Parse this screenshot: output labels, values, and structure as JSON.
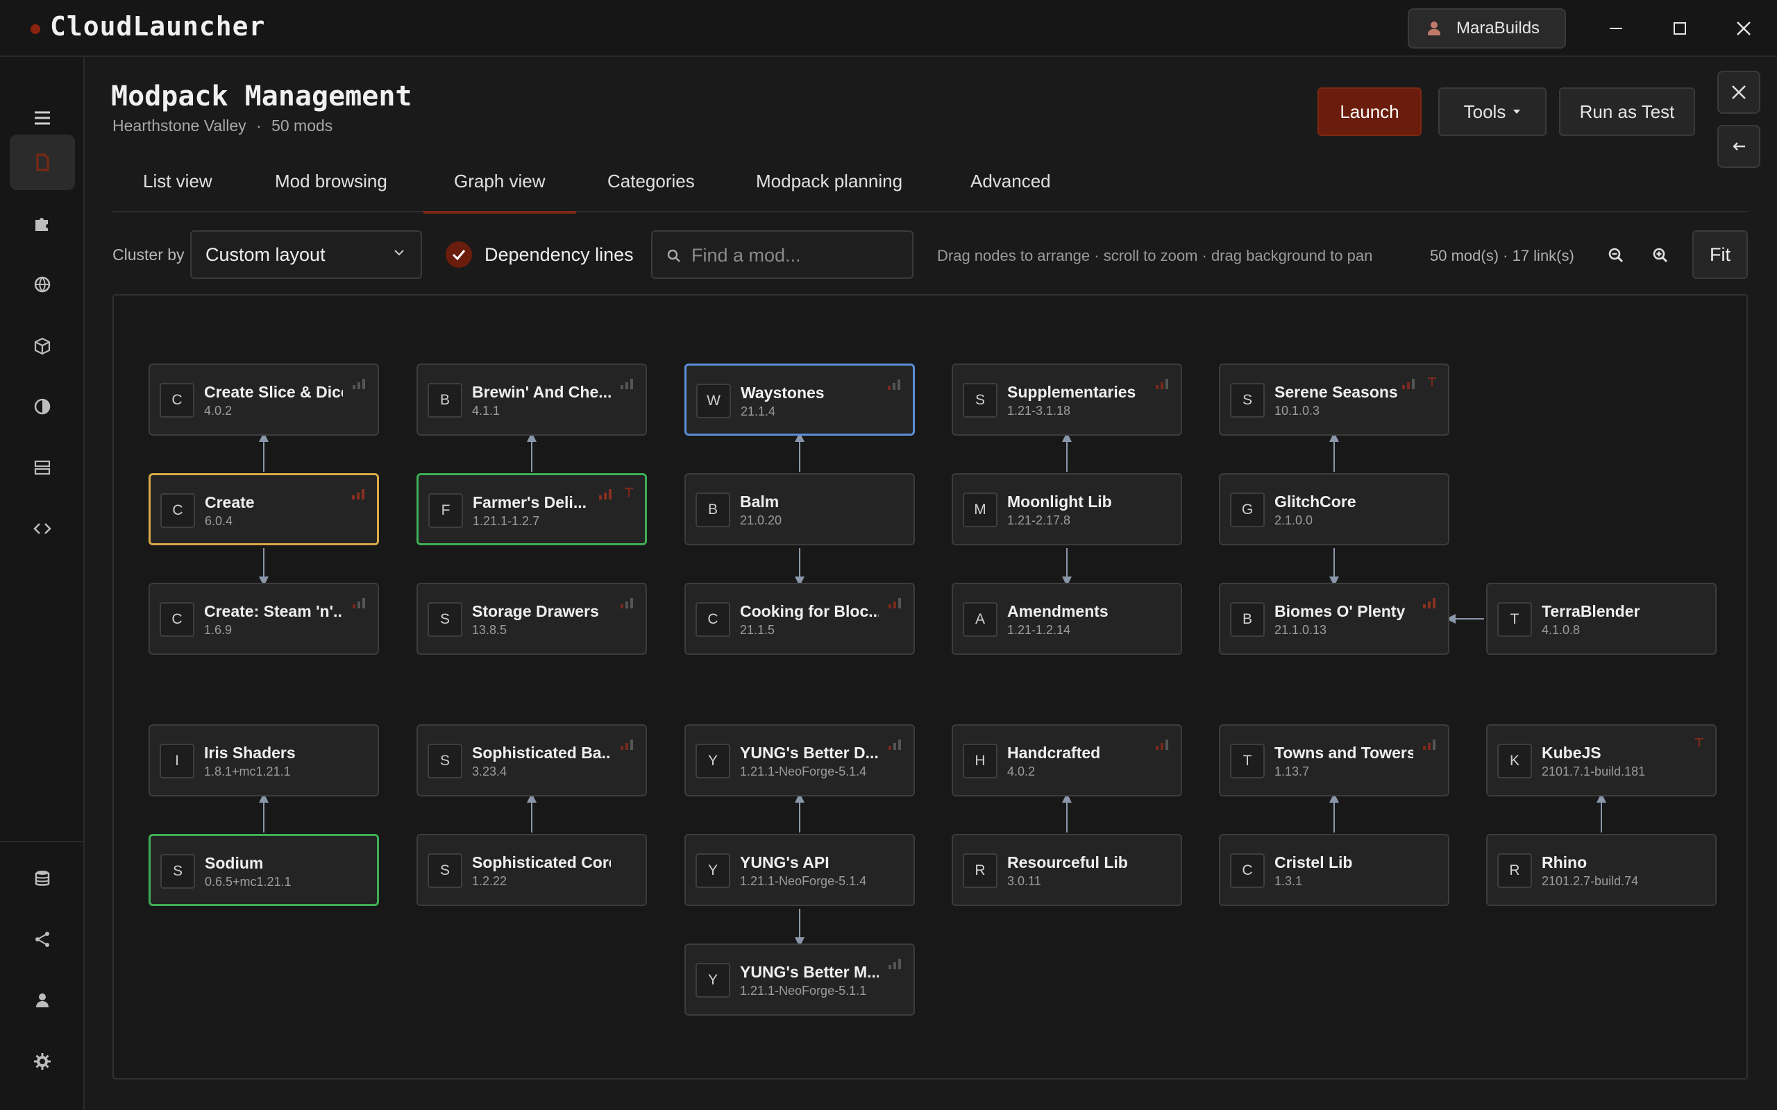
{
  "app": {
    "title": "CloudLauncher",
    "user": "MaraBuilds"
  },
  "header": {
    "title": "Modpack Management",
    "pack_name": "Hearthstone Valley",
    "separator": "·",
    "mod_count": "50 mods",
    "launch": "Launch",
    "tools": "Tools",
    "run_test": "Run as Test"
  },
  "tabs": [
    "List view",
    "Mod browsing",
    "Graph view",
    "Categories",
    "Modpack planning",
    "Advanced"
  ],
  "active_tab": "Graph view",
  "toolbar": {
    "cluster_label": "Cluster by",
    "cluster_value": "Custom layout",
    "dependency_lines": "Dependency lines",
    "search_placeholder": "Find a mod...",
    "hint": "Drag nodes to arrange · scroll to zoom · drag background to pan",
    "counts": "50 mod(s)  ·  17 link(s)",
    "fit": "Fit"
  },
  "colors": {
    "accent": "#6a1d0c",
    "selected_blue": "#5a8fd8",
    "selected_yellow": "#d9a94a",
    "selected_green": "#3fae55",
    "link": "#8a96aa"
  },
  "nodes": [
    {
      "letter": "C",
      "name": "Create Slice & Dice",
      "version": "4.0.2"
    },
    {
      "letter": "B",
      "name": "Brewin' And Che...",
      "version": "4.1.1"
    },
    {
      "letter": "W",
      "name": "Waystones",
      "version": "21.1.4"
    },
    {
      "letter": "S",
      "name": "Supplementaries",
      "version": "1.21-3.1.18"
    },
    {
      "letter": "S",
      "name": "Serene Seasons",
      "version": "10.1.0.3"
    },
    {
      "letter": "C",
      "name": "Create",
      "version": "6.0.4"
    },
    {
      "letter": "F",
      "name": "Farmer's Deli...",
      "version": "1.21.1-1.2.7"
    },
    {
      "letter": "B",
      "name": "Balm",
      "version": "21.0.20"
    },
    {
      "letter": "M",
      "name": "Moonlight Lib",
      "version": "1.21-2.17.8"
    },
    {
      "letter": "G",
      "name": "GlitchCore",
      "version": "2.1.0.0"
    },
    {
      "letter": "C",
      "name": "Create: Steam 'n'...",
      "version": "1.6.9"
    },
    {
      "letter": "S",
      "name": "Storage Drawers",
      "version": "13.8.5"
    },
    {
      "letter": "C",
      "name": "Cooking for Bloc...",
      "version": "21.1.5"
    },
    {
      "letter": "A",
      "name": "Amendments",
      "version": "1.21-1.2.14"
    },
    {
      "letter": "B",
      "name": "Biomes O' Plenty",
      "version": "21.1.0.13"
    },
    {
      "letter": "T",
      "name": "TerraBlender",
      "version": "4.1.0.8"
    },
    {
      "letter": "I",
      "name": "Iris Shaders",
      "version": "1.8.1+mc1.21.1"
    },
    {
      "letter": "S",
      "name": "Sophisticated Ba...",
      "version": "3.23.4"
    },
    {
      "letter": "Y",
      "name": "YUNG's Better D...",
      "version": "1.21.1-NeoForge-5.1.4"
    },
    {
      "letter": "H",
      "name": "Handcrafted",
      "version": "4.0.2"
    },
    {
      "letter": "T",
      "name": "Towns and Towers",
      "version": "1.13.7"
    },
    {
      "letter": "K",
      "name": "KubeJS",
      "version": "2101.7.1-build.181"
    },
    {
      "letter": "S",
      "name": "Sodium",
      "version": "0.6.5+mc1.21.1"
    },
    {
      "letter": "S",
      "name": "Sophisticated Core",
      "version": "1.2.22"
    },
    {
      "letter": "Y",
      "name": "YUNG's API",
      "version": "1.21.1-NeoForge-5.1.4"
    },
    {
      "letter": "R",
      "name": "Resourceful Lib",
      "version": "3.0.11"
    },
    {
      "letter": "C",
      "name": "Cristel Lib",
      "version": "1.3.1"
    },
    {
      "letter": "R",
      "name": "Rhino",
      "version": "2101.2.7-build.74"
    },
    {
      "letter": "Y",
      "name": "YUNG's Better M...",
      "version": "1.21.1-NeoForge-5.1.1"
    }
  ]
}
